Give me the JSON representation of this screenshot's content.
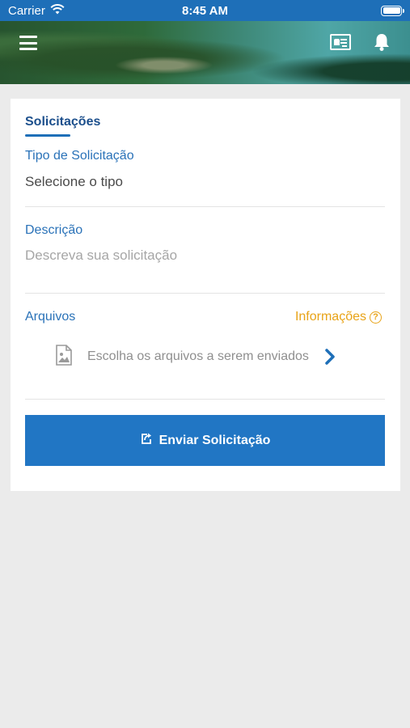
{
  "status_bar": {
    "carrier": "Carrier",
    "time": "8:45 AM",
    "icons": [
      "wifi-icon",
      "battery-icon"
    ]
  },
  "header": {
    "icons": [
      "menu-icon",
      "id-card-icon",
      "bell-icon"
    ]
  },
  "form": {
    "section_title": "Solicitações",
    "type_label": "Tipo de Solicitação",
    "type_value": "Selecione o tipo",
    "description_label": "Descrição",
    "description_placeholder": "Descreva sua solicitação",
    "files_label": "Arquivos",
    "info_link": "Informações",
    "files_prompt": "Escolha os arquivos a serem enviados",
    "submit_label": "Enviar Solicitação"
  },
  "colors": {
    "primary": "#2176c4",
    "title": "#1c4f8c",
    "accent": "#e8a317",
    "background": "#ebebeb"
  }
}
